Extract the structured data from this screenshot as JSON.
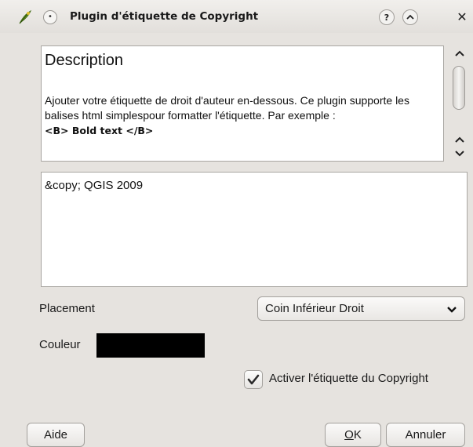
{
  "window": {
    "title": "Plugin d'étiquette de Copyright",
    "help_icon": "question-mark-icon",
    "shade_icon": "chevron-up-icon",
    "close_icon": "close-icon",
    "sticky_icon": "pin-dot-icon",
    "app_icon": "qgis-plugin-icon"
  },
  "description": {
    "heading": "Description",
    "body": "Ajouter votre étiquette de droit d'auteur en-dessous. Ce plugin supporte les balises html simplespour formatter l'étiquette. Par exemple :",
    "example": "<B> Bold text </B>"
  },
  "label_text": {
    "value": "&copy; QGIS 2009"
  },
  "placement": {
    "label": "Placement",
    "selected": "Coin Inférieur Droit"
  },
  "colour": {
    "label": "Couleur",
    "value": "#000000"
  },
  "enable": {
    "label": "Activer l'étiquette du Copyright",
    "checked": true
  },
  "buttons": {
    "help": "Aide",
    "ok_prefix": "O",
    "ok_rest": "K",
    "cancel": "Annuler"
  }
}
